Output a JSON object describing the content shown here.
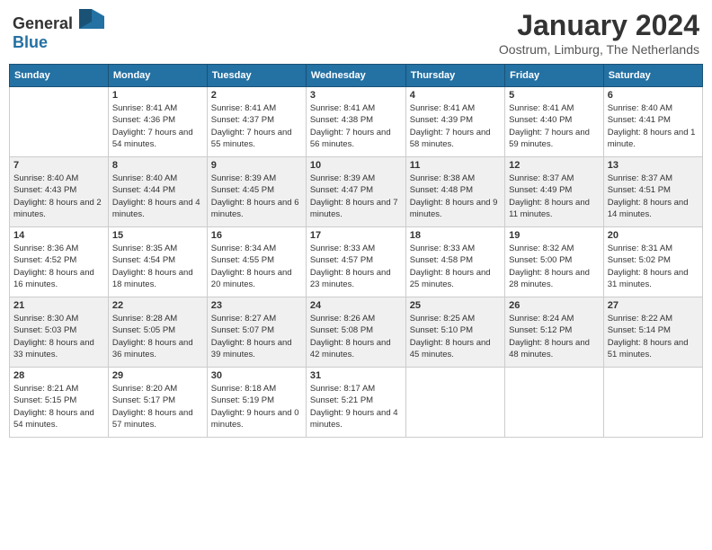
{
  "header": {
    "logo": {
      "general": "General",
      "blue": "Blue"
    },
    "title": "January 2024",
    "location": "Oostrum, Limburg, The Netherlands"
  },
  "days_of_week": [
    "Sunday",
    "Monday",
    "Tuesday",
    "Wednesday",
    "Thursday",
    "Friday",
    "Saturday"
  ],
  "weeks": [
    [
      {
        "day": "",
        "sunrise": "",
        "sunset": "",
        "daylight": ""
      },
      {
        "day": "1",
        "sunrise": "Sunrise: 8:41 AM",
        "sunset": "Sunset: 4:36 PM",
        "daylight": "Daylight: 7 hours and 54 minutes."
      },
      {
        "day": "2",
        "sunrise": "Sunrise: 8:41 AM",
        "sunset": "Sunset: 4:37 PM",
        "daylight": "Daylight: 7 hours and 55 minutes."
      },
      {
        "day": "3",
        "sunrise": "Sunrise: 8:41 AM",
        "sunset": "Sunset: 4:38 PM",
        "daylight": "Daylight: 7 hours and 56 minutes."
      },
      {
        "day": "4",
        "sunrise": "Sunrise: 8:41 AM",
        "sunset": "Sunset: 4:39 PM",
        "daylight": "Daylight: 7 hours and 58 minutes."
      },
      {
        "day": "5",
        "sunrise": "Sunrise: 8:41 AM",
        "sunset": "Sunset: 4:40 PM",
        "daylight": "Daylight: 7 hours and 59 minutes."
      },
      {
        "day": "6",
        "sunrise": "Sunrise: 8:40 AM",
        "sunset": "Sunset: 4:41 PM",
        "daylight": "Daylight: 8 hours and 1 minute."
      }
    ],
    [
      {
        "day": "7",
        "sunrise": "Sunrise: 8:40 AM",
        "sunset": "Sunset: 4:43 PM",
        "daylight": "Daylight: 8 hours and 2 minutes."
      },
      {
        "day": "8",
        "sunrise": "Sunrise: 8:40 AM",
        "sunset": "Sunset: 4:44 PM",
        "daylight": "Daylight: 8 hours and 4 minutes."
      },
      {
        "day": "9",
        "sunrise": "Sunrise: 8:39 AM",
        "sunset": "Sunset: 4:45 PM",
        "daylight": "Daylight: 8 hours and 6 minutes."
      },
      {
        "day": "10",
        "sunrise": "Sunrise: 8:39 AM",
        "sunset": "Sunset: 4:47 PM",
        "daylight": "Daylight: 8 hours and 7 minutes."
      },
      {
        "day": "11",
        "sunrise": "Sunrise: 8:38 AM",
        "sunset": "Sunset: 4:48 PM",
        "daylight": "Daylight: 8 hours and 9 minutes."
      },
      {
        "day": "12",
        "sunrise": "Sunrise: 8:37 AM",
        "sunset": "Sunset: 4:49 PM",
        "daylight": "Daylight: 8 hours and 11 minutes."
      },
      {
        "day": "13",
        "sunrise": "Sunrise: 8:37 AM",
        "sunset": "Sunset: 4:51 PM",
        "daylight": "Daylight: 8 hours and 14 minutes."
      }
    ],
    [
      {
        "day": "14",
        "sunrise": "Sunrise: 8:36 AM",
        "sunset": "Sunset: 4:52 PM",
        "daylight": "Daylight: 8 hours and 16 minutes."
      },
      {
        "day": "15",
        "sunrise": "Sunrise: 8:35 AM",
        "sunset": "Sunset: 4:54 PM",
        "daylight": "Daylight: 8 hours and 18 minutes."
      },
      {
        "day": "16",
        "sunrise": "Sunrise: 8:34 AM",
        "sunset": "Sunset: 4:55 PM",
        "daylight": "Daylight: 8 hours and 20 minutes."
      },
      {
        "day": "17",
        "sunrise": "Sunrise: 8:33 AM",
        "sunset": "Sunset: 4:57 PM",
        "daylight": "Daylight: 8 hours and 23 minutes."
      },
      {
        "day": "18",
        "sunrise": "Sunrise: 8:33 AM",
        "sunset": "Sunset: 4:58 PM",
        "daylight": "Daylight: 8 hours and 25 minutes."
      },
      {
        "day": "19",
        "sunrise": "Sunrise: 8:32 AM",
        "sunset": "Sunset: 5:00 PM",
        "daylight": "Daylight: 8 hours and 28 minutes."
      },
      {
        "day": "20",
        "sunrise": "Sunrise: 8:31 AM",
        "sunset": "Sunset: 5:02 PM",
        "daylight": "Daylight: 8 hours and 31 minutes."
      }
    ],
    [
      {
        "day": "21",
        "sunrise": "Sunrise: 8:30 AM",
        "sunset": "Sunset: 5:03 PM",
        "daylight": "Daylight: 8 hours and 33 minutes."
      },
      {
        "day": "22",
        "sunrise": "Sunrise: 8:28 AM",
        "sunset": "Sunset: 5:05 PM",
        "daylight": "Daylight: 8 hours and 36 minutes."
      },
      {
        "day": "23",
        "sunrise": "Sunrise: 8:27 AM",
        "sunset": "Sunset: 5:07 PM",
        "daylight": "Daylight: 8 hours and 39 minutes."
      },
      {
        "day": "24",
        "sunrise": "Sunrise: 8:26 AM",
        "sunset": "Sunset: 5:08 PM",
        "daylight": "Daylight: 8 hours and 42 minutes."
      },
      {
        "day": "25",
        "sunrise": "Sunrise: 8:25 AM",
        "sunset": "Sunset: 5:10 PM",
        "daylight": "Daylight: 8 hours and 45 minutes."
      },
      {
        "day": "26",
        "sunrise": "Sunrise: 8:24 AM",
        "sunset": "Sunset: 5:12 PM",
        "daylight": "Daylight: 8 hours and 48 minutes."
      },
      {
        "day": "27",
        "sunrise": "Sunrise: 8:22 AM",
        "sunset": "Sunset: 5:14 PM",
        "daylight": "Daylight: 8 hours and 51 minutes."
      }
    ],
    [
      {
        "day": "28",
        "sunrise": "Sunrise: 8:21 AM",
        "sunset": "Sunset: 5:15 PM",
        "daylight": "Daylight: 8 hours and 54 minutes."
      },
      {
        "day": "29",
        "sunrise": "Sunrise: 8:20 AM",
        "sunset": "Sunset: 5:17 PM",
        "daylight": "Daylight: 8 hours and 57 minutes."
      },
      {
        "day": "30",
        "sunrise": "Sunrise: 8:18 AM",
        "sunset": "Sunset: 5:19 PM",
        "daylight": "Daylight: 9 hours and 0 minutes."
      },
      {
        "day": "31",
        "sunrise": "Sunrise: 8:17 AM",
        "sunset": "Sunset: 5:21 PM",
        "daylight": "Daylight: 9 hours and 4 minutes."
      },
      {
        "day": "",
        "sunrise": "",
        "sunset": "",
        "daylight": ""
      },
      {
        "day": "",
        "sunrise": "",
        "sunset": "",
        "daylight": ""
      },
      {
        "day": "",
        "sunrise": "",
        "sunset": "",
        "daylight": ""
      }
    ]
  ]
}
